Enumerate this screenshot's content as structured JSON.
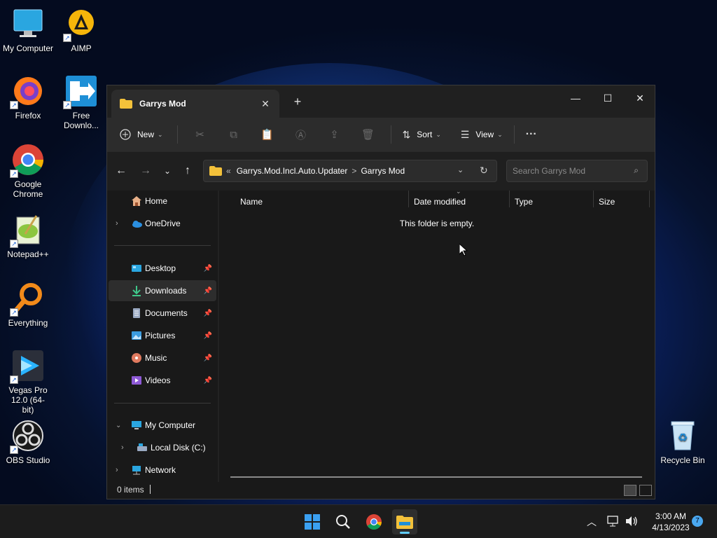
{
  "desktop": {
    "icons": [
      {
        "label": "My Computer"
      },
      {
        "label": "AIMP"
      },
      {
        "label": "Firefox"
      },
      {
        "label": "Free Downlo..."
      },
      {
        "label": "Google Chrome"
      },
      {
        "label": "Notepad++"
      },
      {
        "label": "Everything"
      },
      {
        "label": "Vegas Pro 12.0 (64-bit)"
      },
      {
        "label": "OBS Studio"
      },
      {
        "label": "Recycle Bin"
      }
    ]
  },
  "window": {
    "tab_title": "Garrys Mod",
    "tab_close": "✕",
    "new_tab": "+",
    "controls": {
      "minimize": "—",
      "maximize": "☐",
      "close": "✕"
    },
    "toolbar": {
      "new_label": "New",
      "sort_label": "Sort",
      "view_label": "View",
      "more_label": "···"
    },
    "address": {
      "overflow": "«",
      "crumbs": [
        "Garrys.Mod.Incl.Auto.Updater",
        "Garrys Mod"
      ],
      "separator": ">"
    },
    "search": {
      "placeholder": "Search Garrys Mod"
    },
    "nav": {
      "home": "Home",
      "onedrive": "OneDrive",
      "quick": [
        {
          "label": "Desktop"
        },
        {
          "label": "Downloads"
        },
        {
          "label": "Documents"
        },
        {
          "label": "Pictures"
        },
        {
          "label": "Music"
        },
        {
          "label": "Videos"
        }
      ],
      "my_computer": "My Computer",
      "local_disk": "Local Disk (C:)",
      "network": "Network"
    },
    "columns": [
      "Name",
      "Date modified",
      "Type",
      "Size"
    ],
    "empty_message": "This folder is empty.",
    "status": {
      "items": "0 items"
    }
  },
  "taskbar": {
    "time": "3:00 AM",
    "date": "4/13/2023",
    "notification_count": "7"
  },
  "colors": {
    "accent": "#60cdff",
    "folder": "#f3c13a",
    "window_bg": "#191919",
    "toolbar_bg": "#2c2c2c"
  }
}
